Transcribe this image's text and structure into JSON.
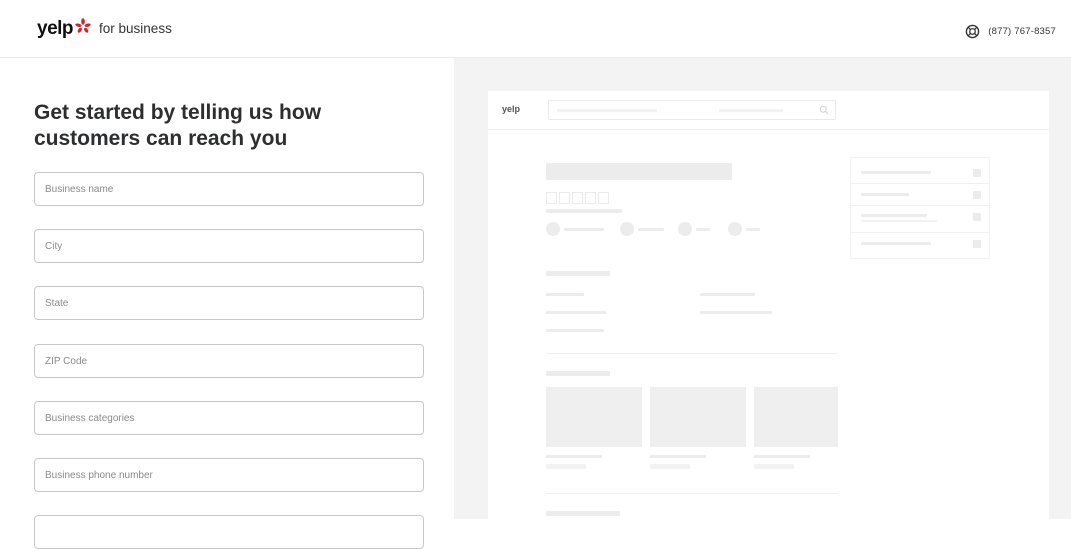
{
  "header": {
    "logo_text": "yelp",
    "logo_suffix": "for business",
    "phone": "(877) 767-8357",
    "brand_color": "#d32323"
  },
  "form": {
    "heading": "Get started by telling us how customers can reach you",
    "fields": [
      {
        "placeholder": "Business name",
        "value": ""
      },
      {
        "placeholder": "City",
        "value": ""
      },
      {
        "placeholder": "State",
        "value": ""
      },
      {
        "placeholder": "ZIP Code",
        "value": ""
      },
      {
        "placeholder": "Business categories",
        "value": ""
      },
      {
        "placeholder": "Business phone number",
        "value": ""
      },
      {
        "placeholder": "",
        "value": ""
      }
    ]
  },
  "preview": {
    "logo_text": "yelp"
  }
}
